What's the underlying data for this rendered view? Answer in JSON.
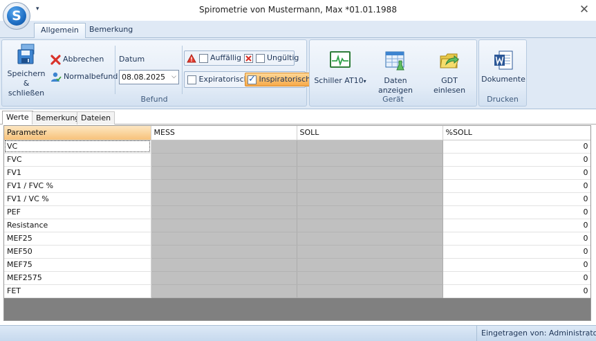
{
  "window": {
    "title": "Spirometrie von Mustermann, Max *01.01.1988",
    "orb_letter": "S",
    "qat_glyph": "▾",
    "close_glyph": "✕"
  },
  "ribbon_tabs": [
    {
      "label": "Allgemein",
      "active": true
    },
    {
      "label": "Bemerkung",
      "active": false
    }
  ],
  "groups": {
    "befund": {
      "label": "Befund",
      "save_label_line1": "Speichern",
      "save_label_line2": "& schließen",
      "cancel_label": "Abbrechen",
      "normal_label": "Normalbefund",
      "date_label": "Datum",
      "date_value": "08.08.2025",
      "flags": [
        {
          "label": "Auffällig",
          "checked": false,
          "icon": "warning-icon"
        },
        {
          "label": "Ungültig",
          "checked": false,
          "icon": "invalid-x-icon"
        }
      ],
      "modes": [
        {
          "label": "Expiratorisch",
          "checked": false
        },
        {
          "label": "Inspiratorisch",
          "checked": true
        }
      ]
    },
    "geraet": {
      "label": "Gerät",
      "device_label": "Schiller AT10",
      "device_arrow": "▾",
      "show_data_label": "Daten anzeigen",
      "gdt_label": "GDT einlesen"
    },
    "drucken": {
      "label": "Drucken",
      "documents_label": "Dokumente"
    }
  },
  "inner_tabs": [
    {
      "label": "Werte",
      "active": true
    },
    {
      "label": "Bemerkung",
      "active": false
    },
    {
      "label": "Dateien",
      "active": false
    }
  ],
  "grid": {
    "columns": [
      "Parameter",
      "MESS",
      "SOLL",
      "%SOLL"
    ],
    "rows": [
      {
        "parameter": "VC",
        "mess": "",
        "soll": "",
        "pct": "0"
      },
      {
        "parameter": "FVC",
        "mess": "",
        "soll": "",
        "pct": "0"
      },
      {
        "parameter": "FV1",
        "mess": "",
        "soll": "",
        "pct": "0"
      },
      {
        "parameter": "FV1 / FVC %",
        "mess": "",
        "soll": "",
        "pct": "0"
      },
      {
        "parameter": "FV1 / VC %",
        "mess": "",
        "soll": "",
        "pct": "0"
      },
      {
        "parameter": "PEF",
        "mess": "",
        "soll": "",
        "pct": "0"
      },
      {
        "parameter": "Resistance",
        "mess": "",
        "soll": "",
        "pct": "0"
      },
      {
        "parameter": "MEF25",
        "mess": "",
        "soll": "",
        "pct": "0"
      },
      {
        "parameter": "MEF50",
        "mess": "",
        "soll": "",
        "pct": "0"
      },
      {
        "parameter": "MEF75",
        "mess": "",
        "soll": "",
        "pct": "0"
      },
      {
        "parameter": "MEF2575",
        "mess": "",
        "soll": "",
        "pct": "0"
      },
      {
        "parameter": "FET",
        "mess": "",
        "soll": "",
        "pct": "0"
      }
    ]
  },
  "statusbar": {
    "text": "Eingetragen von: Administrator,"
  },
  "colors": {
    "accent": "#1f6fc4",
    "ribbon_bg": "#dfe9f5",
    "active_check": "#f7a94a"
  }
}
